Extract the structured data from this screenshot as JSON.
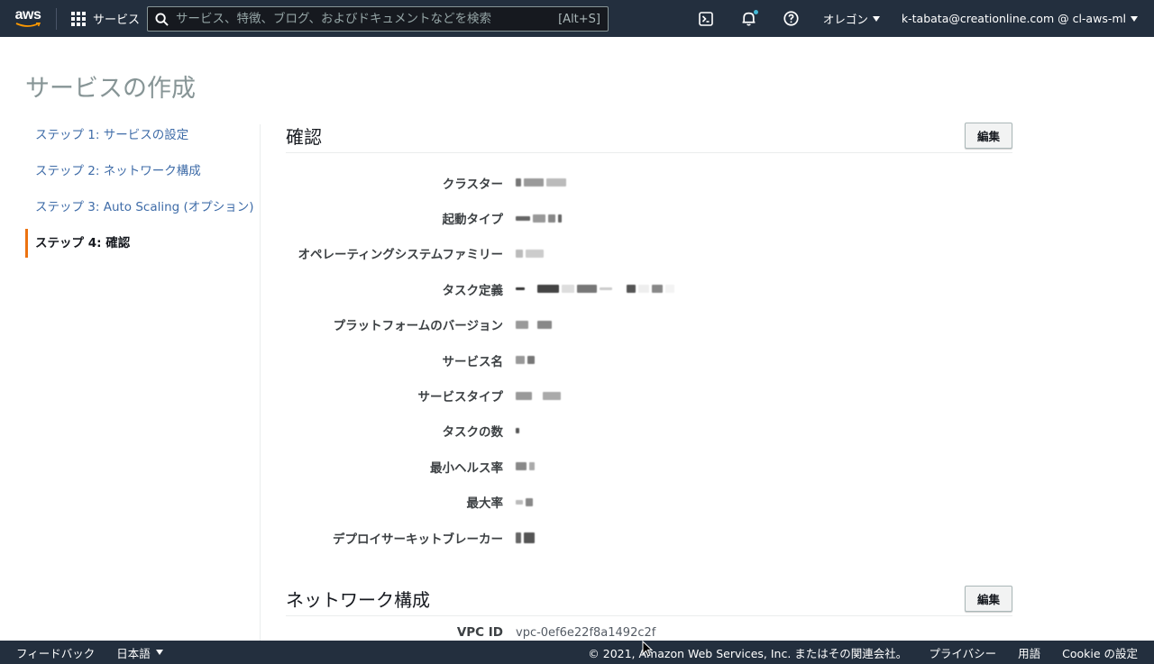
{
  "topnav": {
    "logo_text": "aws",
    "services_label": "サービス",
    "search_placeholder": "サービス、特徴、ブログ、およびドキュメントなどを検索",
    "search_shortcut": "[Alt+S]",
    "region_label": "オレゴン",
    "account_label": "k-tabata@creationline.com @ cl-aws-ml",
    "icons": [
      "cloudshell-icon",
      "bell-icon",
      "help-icon"
    ]
  },
  "page": {
    "title": "サービスの作成"
  },
  "sidebar": {
    "steps": [
      {
        "label": "ステップ 1: サービスの設定"
      },
      {
        "label": "ステップ 2: ネットワーク構成"
      },
      {
        "label": "ステップ 3: Auto Scaling (オプション)"
      },
      {
        "label": "ステップ 4: 確認"
      }
    ]
  },
  "review": {
    "title": "確認",
    "edit_label": "編集",
    "rows": [
      {
        "label": "クラスター"
      },
      {
        "label": "起動タイプ"
      },
      {
        "label": "オペレーティングシステムファミリー"
      },
      {
        "label": "タスク定義"
      },
      {
        "label": "プラットフォームのバージョン"
      },
      {
        "label": "サービス名"
      },
      {
        "label": "サービスタイプ"
      },
      {
        "label": "タスクの数"
      },
      {
        "label": "最小ヘルス率"
      },
      {
        "label": "最大率"
      },
      {
        "label": "デプロイサーキットブレーカー"
      }
    ]
  },
  "network": {
    "title": "ネットワーク構成",
    "edit_label": "編集",
    "vpc_label": "VPC ID",
    "vpc_value": "vpc-0ef6e22f8a1492c2f"
  },
  "footer": {
    "feedback": "フィードバック",
    "language": "日本語",
    "copyright": "© 2021, Amazon Web Services, Inc. またはその関連会社。",
    "privacy": "プライバシー",
    "terms": "用語",
    "cookie": "Cookie の設定"
  },
  "colors": {
    "nav_bg": "#232f3e",
    "link": "#3f6ca8",
    "accent": "#ec7211"
  }
}
